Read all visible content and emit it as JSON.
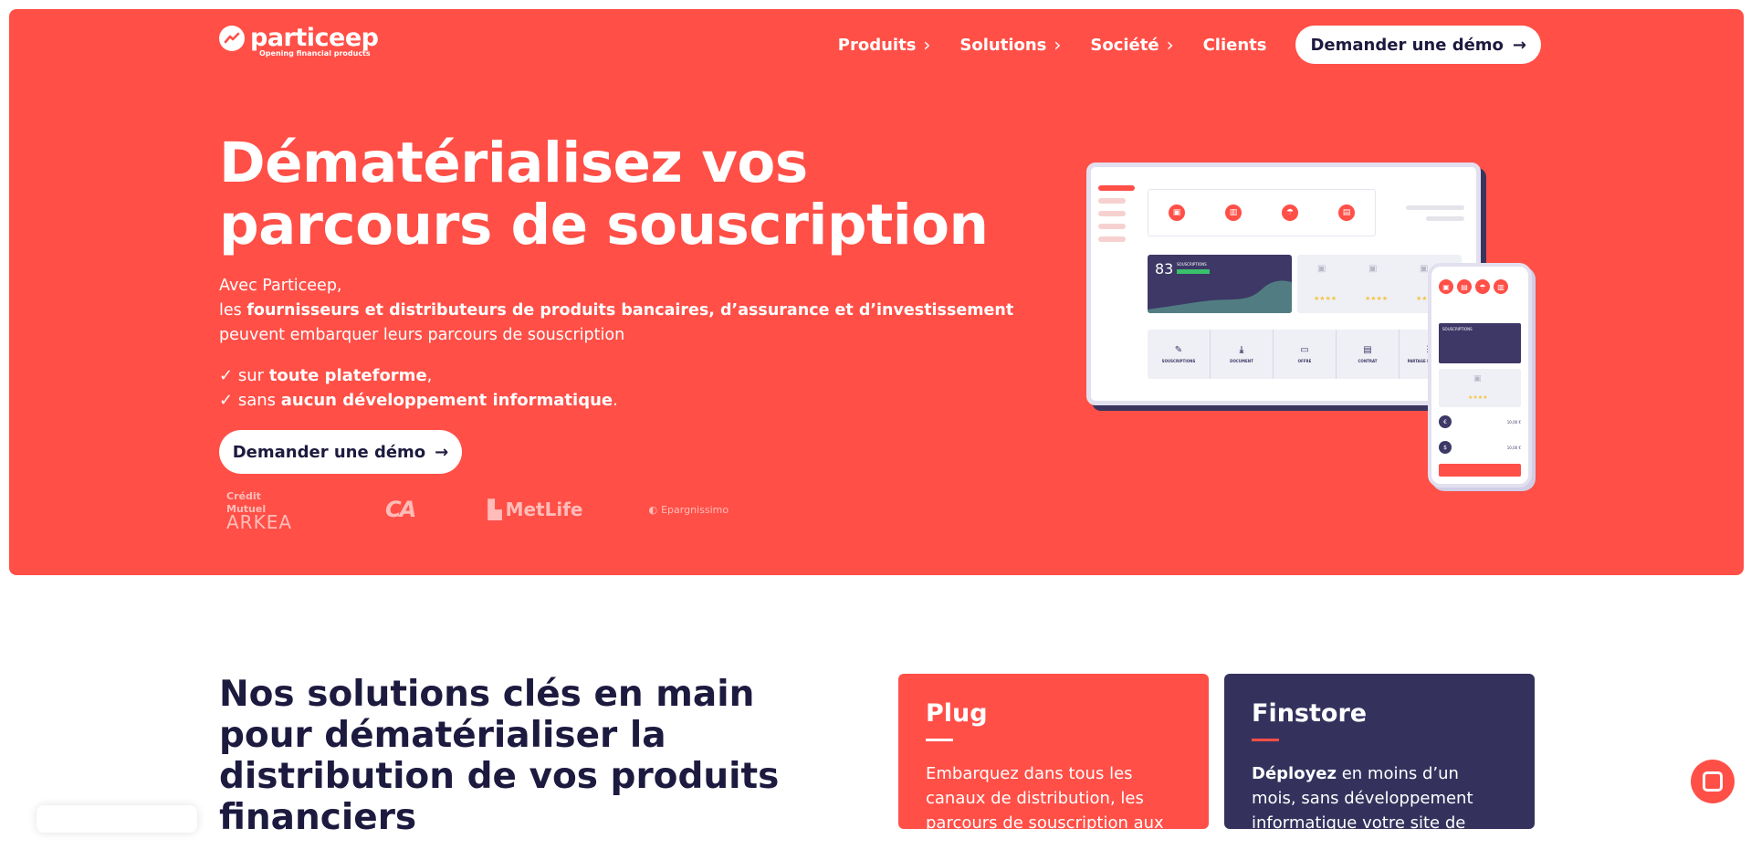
{
  "brand": {
    "name": "particeep",
    "tagline": "Opening financial products",
    "accent": "#ff4f47",
    "dark": "#34325d"
  },
  "nav": {
    "items": [
      {
        "label": "Produits",
        "icon": "chevron-right-icon"
      },
      {
        "label": "Solutions",
        "icon": "chevron-right-icon"
      },
      {
        "label": "Société",
        "icon": "chevron-right-icon"
      },
      {
        "label": "Clients"
      }
    ],
    "cta": "Demander une démo"
  },
  "hero": {
    "title": "Dématérialisez vos parcours de souscription",
    "intro_line1": "Avec Particeep,",
    "intro_pre": "les ",
    "intro_bold": "fournisseurs et distributeurs de produits bancaires, d’assurance et d’investissement",
    "intro_post": " peuvent embarquer leurs parcours de souscription",
    "check1_pre": "sur ",
    "check1_bold": "toute plateforme",
    "check1_post": ",",
    "check2_pre": "sans ",
    "check2_bold": "aucun développement informatique",
    "check2_post": ".",
    "cta": "Demander une démo",
    "partners": {
      "p1a": "Crédit Mutuel",
      "p1b": "ARKEA",
      "p2": "CA",
      "p3": "MetLife",
      "p4": "Epargnissimo"
    }
  },
  "mockup": {
    "kpi": "83",
    "kpi_label": "SOUSCRIPTIONS",
    "steps": [
      "SOUSCRIPTIONS",
      "DOCUMENT",
      "OFFRE",
      "CONTRAT",
      "PARTAGE DE DONNÉES"
    ],
    "phone_dash_label": "SOUSCRIPTIONS",
    "phone_val1": "€",
    "phone_val1_amount": "10,00 €",
    "phone_val2": "$",
    "phone_val2_amount": "10,00 €"
  },
  "section2": {
    "title": "Nos solutions clés en main pour dématérialiser la distribution de vos produits financiers",
    "cards": [
      {
        "title": "Plug",
        "text": "Embarquez dans tous les canaux de distribution, les parcours de souscription aux produits"
      },
      {
        "title": "Finstore",
        "text_bold": "Déployez",
        "text": " en moins d’un mois, sans développement informatique votre site de"
      }
    ]
  }
}
